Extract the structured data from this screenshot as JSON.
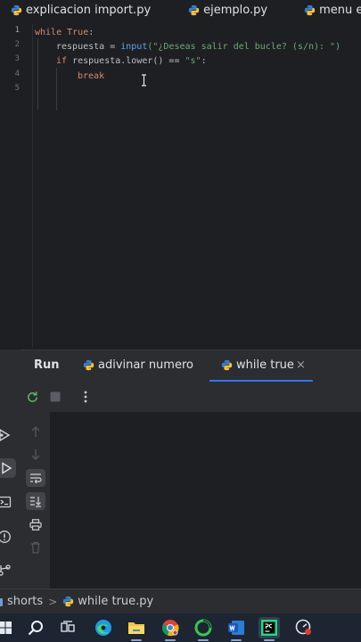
{
  "editor_tabs": [
    {
      "label": "explicacion import.py",
      "icon": "python-file-icon"
    },
    {
      "label": "ejemplo.py",
      "icon": "python-file-icon"
    },
    {
      "label": "menu entrad",
      "icon": "python-file-icon"
    }
  ],
  "editor": {
    "line_numbers": [
      "1",
      "2",
      "3",
      "4",
      "5"
    ],
    "lines": [
      {
        "t1": "while",
        "t2": " ",
        "t3": "True",
        "t4": ":"
      },
      {
        "t1": "respuesta = ",
        "t2": "input",
        "t3": "(\"¿Deseas salir del bucle? (s/n): \")"
      },
      {
        "t1": "if",
        "t2": " respuesta.lower() == ",
        "t3": "\"s\"",
        "t4": ":"
      },
      {
        "t1": "break"
      }
    ]
  },
  "run_panel": {
    "title": "Run",
    "tabs": [
      {
        "label": "adivinar numero",
        "icon": "python-file-icon"
      },
      {
        "label": "while true",
        "icon": "python-file-icon"
      }
    ],
    "close_glyph": "×",
    "toolbar_icons": [
      "rerun-icon",
      "stop-icon",
      "more-vertical-icon"
    ],
    "side_icons": [
      "scroll-up-icon",
      "scroll-down-icon",
      "soft-wrap-icon",
      "scroll-to-end-icon",
      "print-icon",
      "trash-icon"
    ]
  },
  "navbar": {
    "project": "shorts",
    "separator": ">",
    "file": "while true.py"
  },
  "taskbar": {
    "apps": [
      "windows-start-icon",
      "search-icon",
      "task-view-icon",
      "edge-icon",
      "file-explorer-icon",
      "chrome-icon",
      "spotify-like-icon",
      "word-icon",
      "pycharm-icon",
      "recorder-icon"
    ]
  },
  "colors": {
    "background": "#1e1f22",
    "panel": "#2b2d30",
    "keyword": "#cf8e6d",
    "function": "#56a8f5",
    "string": "#6aab73",
    "text": "#bcbec4",
    "accent": "#3574f0"
  }
}
